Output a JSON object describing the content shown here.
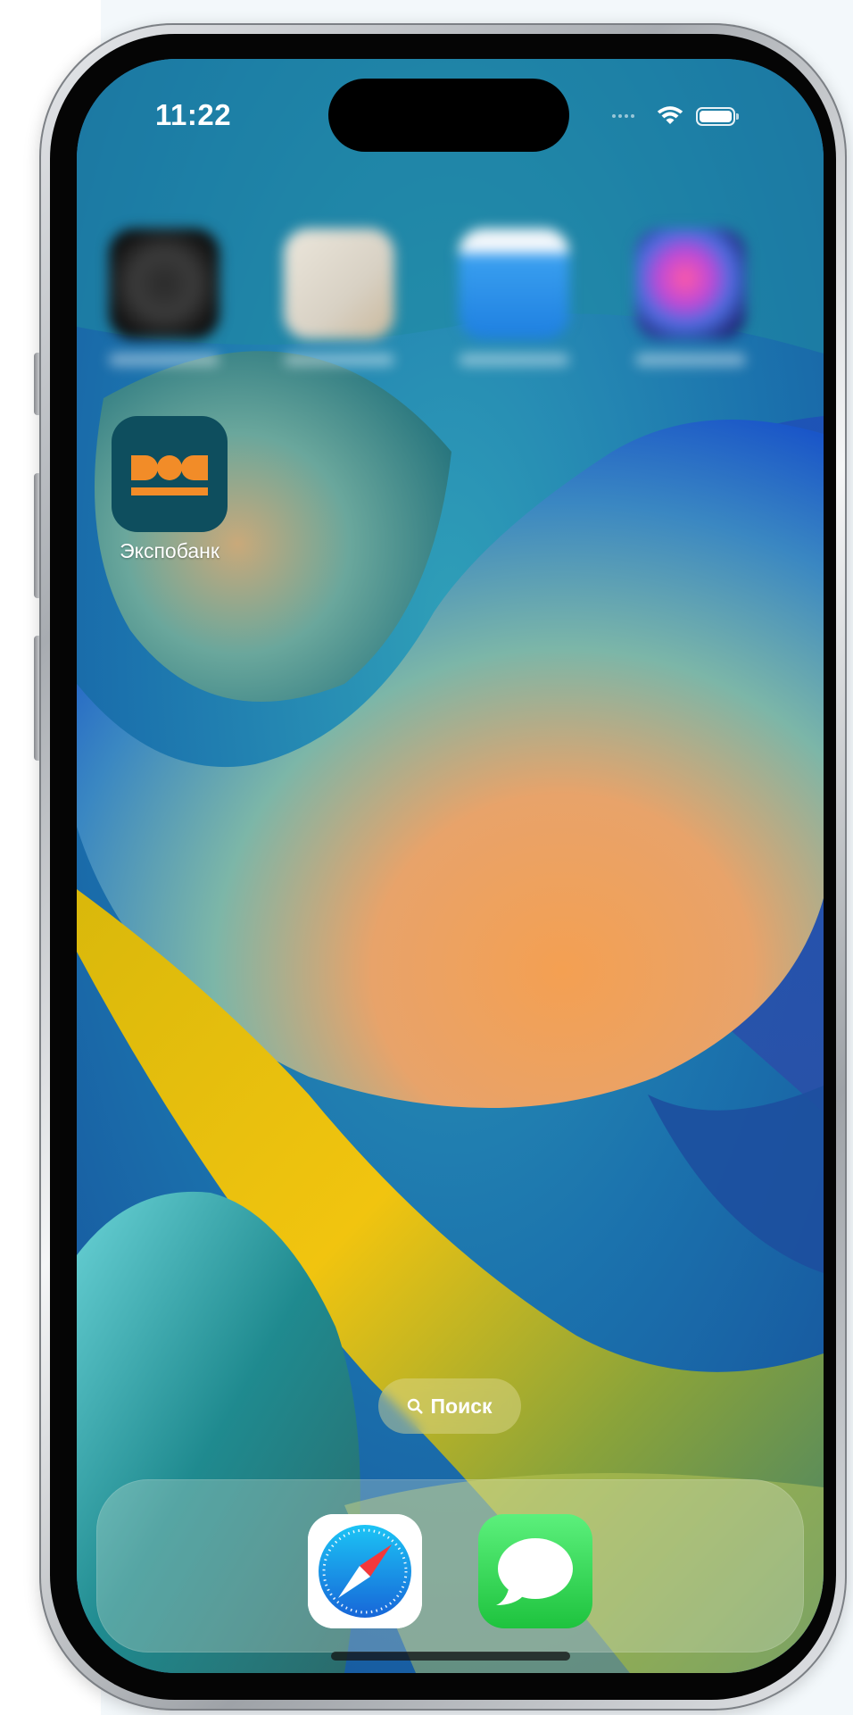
{
  "status_bar": {
    "time": "11:22",
    "wifi_icon": "wifi-icon",
    "battery_icon": "battery-icon",
    "signal_icon": "cellular-signal-icon"
  },
  "home_screen": {
    "blurred_apps": [
      {
        "icon": "watch-app-icon"
      },
      {
        "icon": "contacts-app-icon"
      },
      {
        "icon": "files-app-icon"
      },
      {
        "icon": "shortcuts-app-icon"
      }
    ],
    "apps": [
      {
        "label": "Экспобанк",
        "icon": "expobank-logo-icon",
        "color": "#0e4e5e",
        "accent": "#f28c28"
      }
    ]
  },
  "search": {
    "label": "Поиск",
    "icon": "search-icon"
  },
  "dock": {
    "apps": [
      {
        "name": "Safari",
        "icon": "safari-compass-icon"
      },
      {
        "name": "Messages",
        "icon": "messages-bubble-icon"
      }
    ]
  },
  "colors": {
    "expobank_background": "#0e4e5e",
    "expobank_accent": "#f28c28",
    "messages_green": "#1ec33e",
    "safari_blue": "#1a8ef0"
  }
}
